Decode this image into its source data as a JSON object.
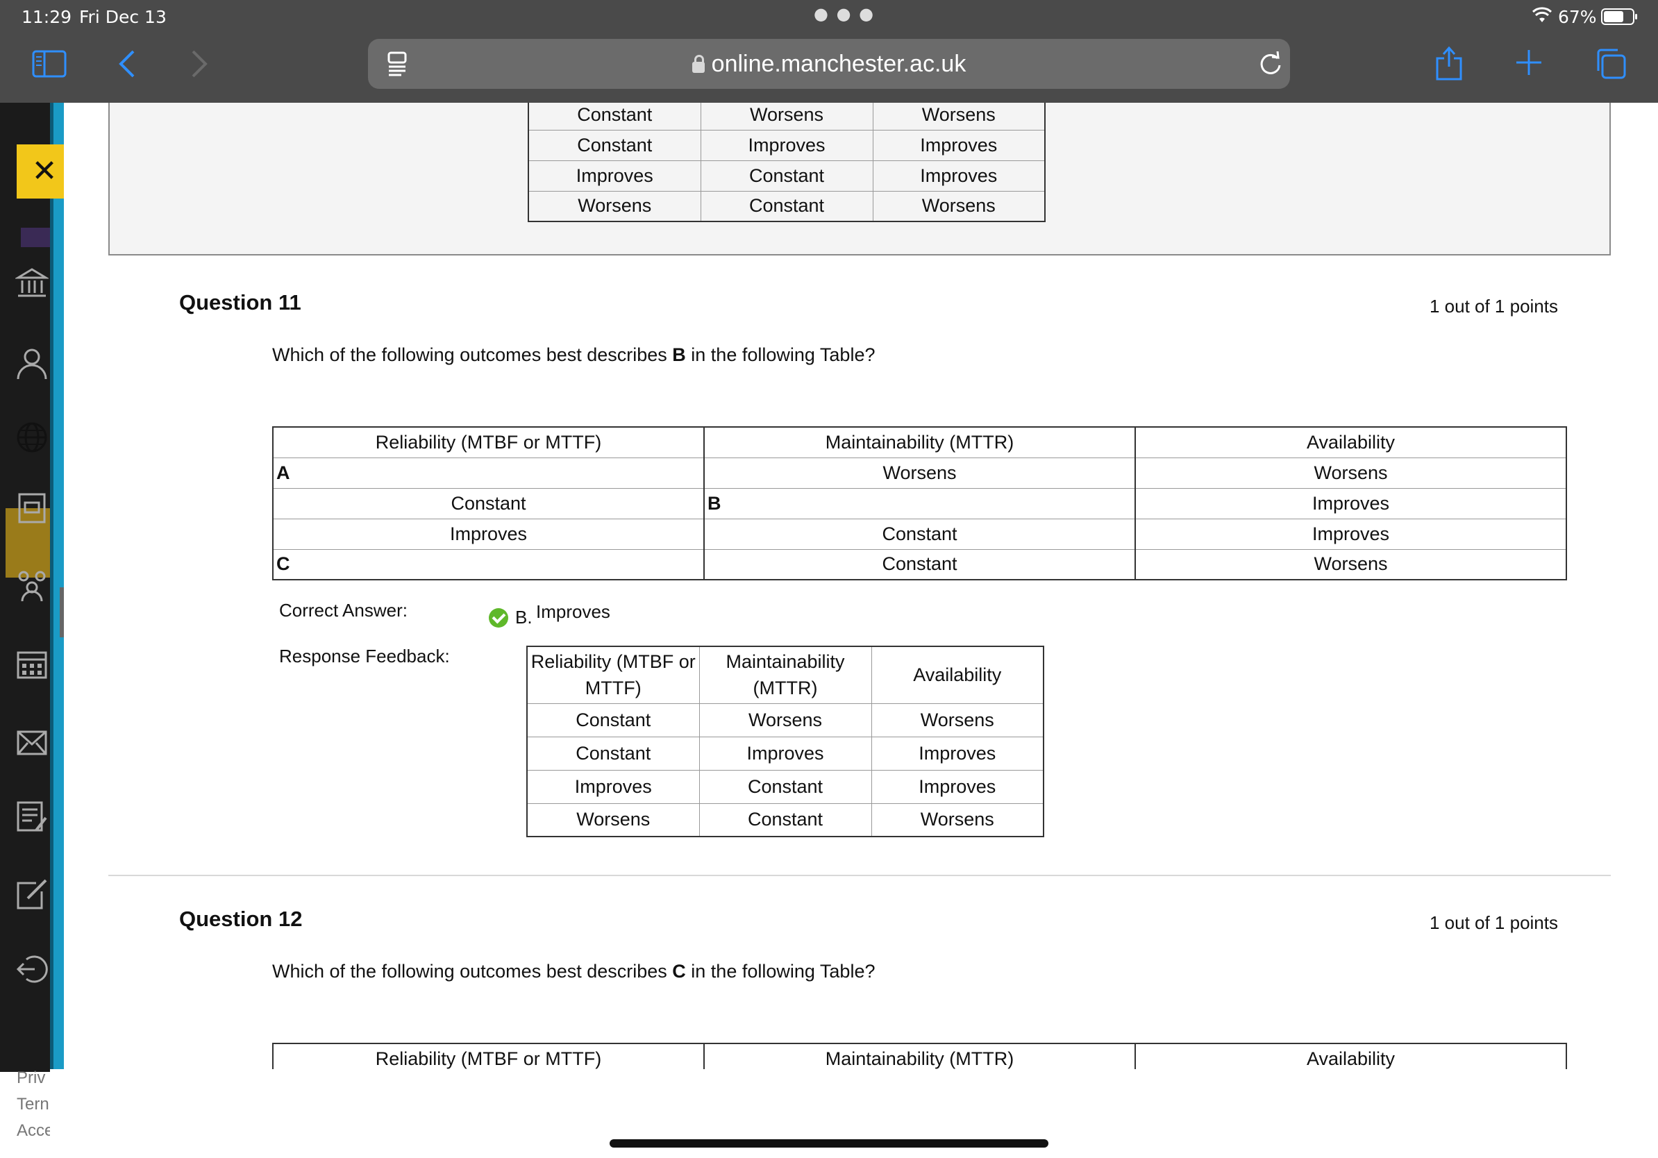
{
  "status": {
    "time": "11:29",
    "date": "Fri Dec 13",
    "battery": "67%"
  },
  "browser": {
    "url": "online.manchester.ac.uk"
  },
  "sidebar": {
    "footer": [
      "Priv",
      "Tern",
      "Acce"
    ]
  },
  "previous_table": {
    "rows": [
      [
        "Constant",
        "Worsens",
        "Worsens"
      ],
      [
        "Constant",
        "Improves",
        "Improves"
      ],
      [
        "Improves",
        "Constant",
        "Improves"
      ],
      [
        "Worsens",
        "Constant",
        "Worsens"
      ]
    ]
  },
  "q11": {
    "title": "Question 11",
    "points": "1 out of 1 points",
    "text_before": "Which of the following outcomes best describes ",
    "text_bold": "B",
    "text_after": " in the following Table?",
    "table": {
      "headers": [
        "Reliability (MTBF or MTTF)",
        "Maintainability (MTTR)",
        "Availability"
      ],
      "rows": [
        [
          "A",
          "Worsens",
          "Worsens"
        ],
        [
          "Constant",
          "B",
          "Improves"
        ],
        [
          "Improves",
          "Constant",
          "Improves"
        ],
        [
          "C",
          "Constant",
          "Worsens"
        ]
      ]
    },
    "correct_label": "Correct Answer:",
    "answer_letter": "B.",
    "answer_text": "Improves",
    "feedback_label": "Response Feedback:",
    "feedback_table": {
      "headers": [
        "Reliability (MTBF or MTTF)",
        "Maintainability (MTTR)",
        "Availability"
      ],
      "rows": [
        [
          "Constant",
          "Worsens",
          "Worsens"
        ],
        [
          "Constant",
          "Improves",
          "Improves"
        ],
        [
          "Improves",
          "Constant",
          "Improves"
        ],
        [
          "Worsens",
          "Constant",
          "Worsens"
        ]
      ]
    }
  },
  "q12": {
    "title": "Question 12",
    "points": "1 out of 1 points",
    "text_before": "Which of the following outcomes best describes ",
    "text_bold": "C",
    "text_after": " in the following Table?",
    "headers": [
      "Reliability (MTBF or MTTF)",
      "Maintainability (MTTR)",
      "Availability"
    ]
  }
}
